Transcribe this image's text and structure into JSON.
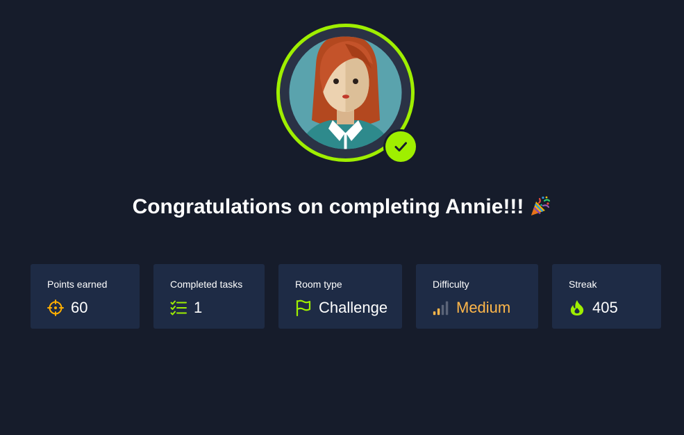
{
  "headline": {
    "text": "Congratulations on completing Annie!!!",
    "icon": "party-popper-icon"
  },
  "avatar": {
    "icon": "user-avatar-female",
    "badge_icon": "checkmark-icon",
    "ring_color": "#9fef00"
  },
  "stats": [
    {
      "label": "Points earned",
      "value": "60",
      "icon": "crosshair-target-icon",
      "icon_color": "#ffaf00",
      "value_color": "#ffffff"
    },
    {
      "label": "Completed tasks",
      "value": "1",
      "icon": "checklist-icon",
      "icon_color": "#9fef00",
      "value_color": "#ffffff"
    },
    {
      "label": "Room type",
      "value": "Challenge",
      "icon": "flag-icon",
      "icon_color": "#9fef00",
      "value_color": "#ffffff"
    },
    {
      "label": "Difficulty",
      "value": "Medium",
      "icon": "signal-bars-icon",
      "icon_color": "#ffb74a",
      "value_color": "#ffb74a"
    },
    {
      "label": "Streak",
      "value": "405",
      "icon": "flame-icon",
      "icon_color": "#9fef00",
      "value_color": "#ffffff"
    }
  ],
  "colors": {
    "background": "#161c2b",
    "card": "#1e2b45",
    "accent_green": "#9fef00",
    "accent_orange": "#ffb74a"
  }
}
